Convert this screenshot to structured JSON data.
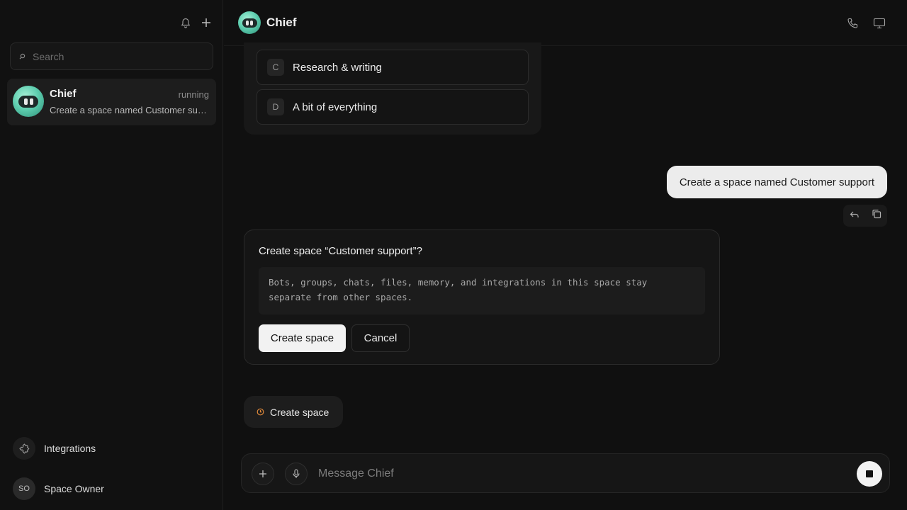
{
  "sidebar": {
    "search_placeholder": "Search",
    "chats": [
      {
        "name": "Chief",
        "status": "running",
        "preview": "Create a space named Customer support"
      }
    ],
    "integrations_label": "Integrations",
    "user": {
      "initials": "SO",
      "name": "Space Owner"
    }
  },
  "header": {
    "title": "Chief"
  },
  "options": [
    {
      "key": "C",
      "label": "Research & writing"
    },
    {
      "key": "D",
      "label": "A bit of everything"
    }
  ],
  "user_message": "Create a space named Customer support",
  "confirm": {
    "title": "Create space “Customer support”?",
    "description": "Bots, groups, chats, files, memory, and integrations in this space stay separate from other spaces.",
    "primary_label": "Create space",
    "secondary_label": "Cancel"
  },
  "tool_status": {
    "label": "Create space"
  },
  "composer": {
    "placeholder": "Message Chief"
  },
  "icons": {
    "bell": "bell-icon",
    "plus": "plus-icon",
    "search": "search-icon",
    "puzzle": "puzzle-icon",
    "phone": "phone-icon",
    "monitor": "monitor-icon",
    "reply": "reply-icon",
    "copy": "copy-icon",
    "mic": "microphone-icon",
    "stop": "stop-icon",
    "clock": "clock-icon"
  },
  "colors": {
    "accent_bot": "#5fcfb0",
    "status_orange": "#e0893a",
    "background": "#101010"
  }
}
